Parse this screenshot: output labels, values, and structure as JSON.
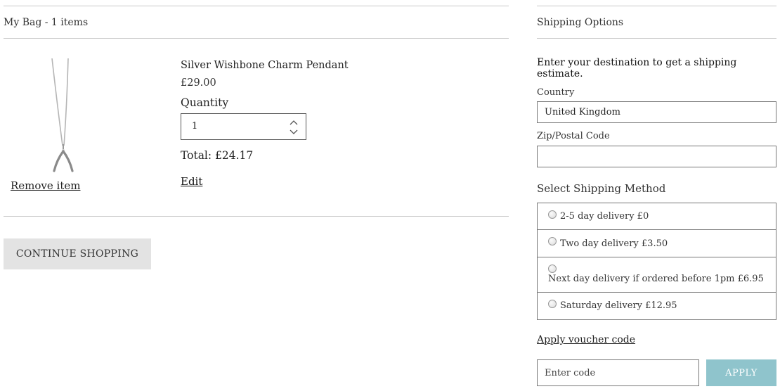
{
  "bag": {
    "title": "My Bag - 1 items",
    "item": {
      "name": "Silver Wishbone Charm Pendant",
      "price": "£29.00",
      "quantity_label": "Quantity",
      "quantity_value": "1",
      "total": "Total: £24.17",
      "remove_label": "Remove item",
      "edit_label": "Edit",
      "image_icon": "wishbone-pendant-image"
    },
    "continue_label": "CONTINUE SHOPPING"
  },
  "shipping": {
    "title": "Shipping Options",
    "intro": "Enter your destination to get a shipping estimate.",
    "country_label": "Country",
    "country_value": "United Kingdom",
    "zip_label": "Zip/Postal Code",
    "zip_value": "",
    "method_heading": "Select Shipping Method",
    "methods": [
      {
        "label": "2-5 day delivery £0"
      },
      {
        "label": "Two day delivery £3.50"
      },
      {
        "label": "Next day delivery if ordered before 1pm £6.95"
      },
      {
        "label": "Saturday delivery £12.95"
      }
    ]
  },
  "voucher": {
    "link_label": "Apply voucher code",
    "placeholder": "Enter code",
    "apply_label": "APPLY"
  },
  "colors": {
    "apply_button": "#8fc4cc",
    "continue_button": "#e3e3e3",
    "rule": "#c8c8c8"
  }
}
